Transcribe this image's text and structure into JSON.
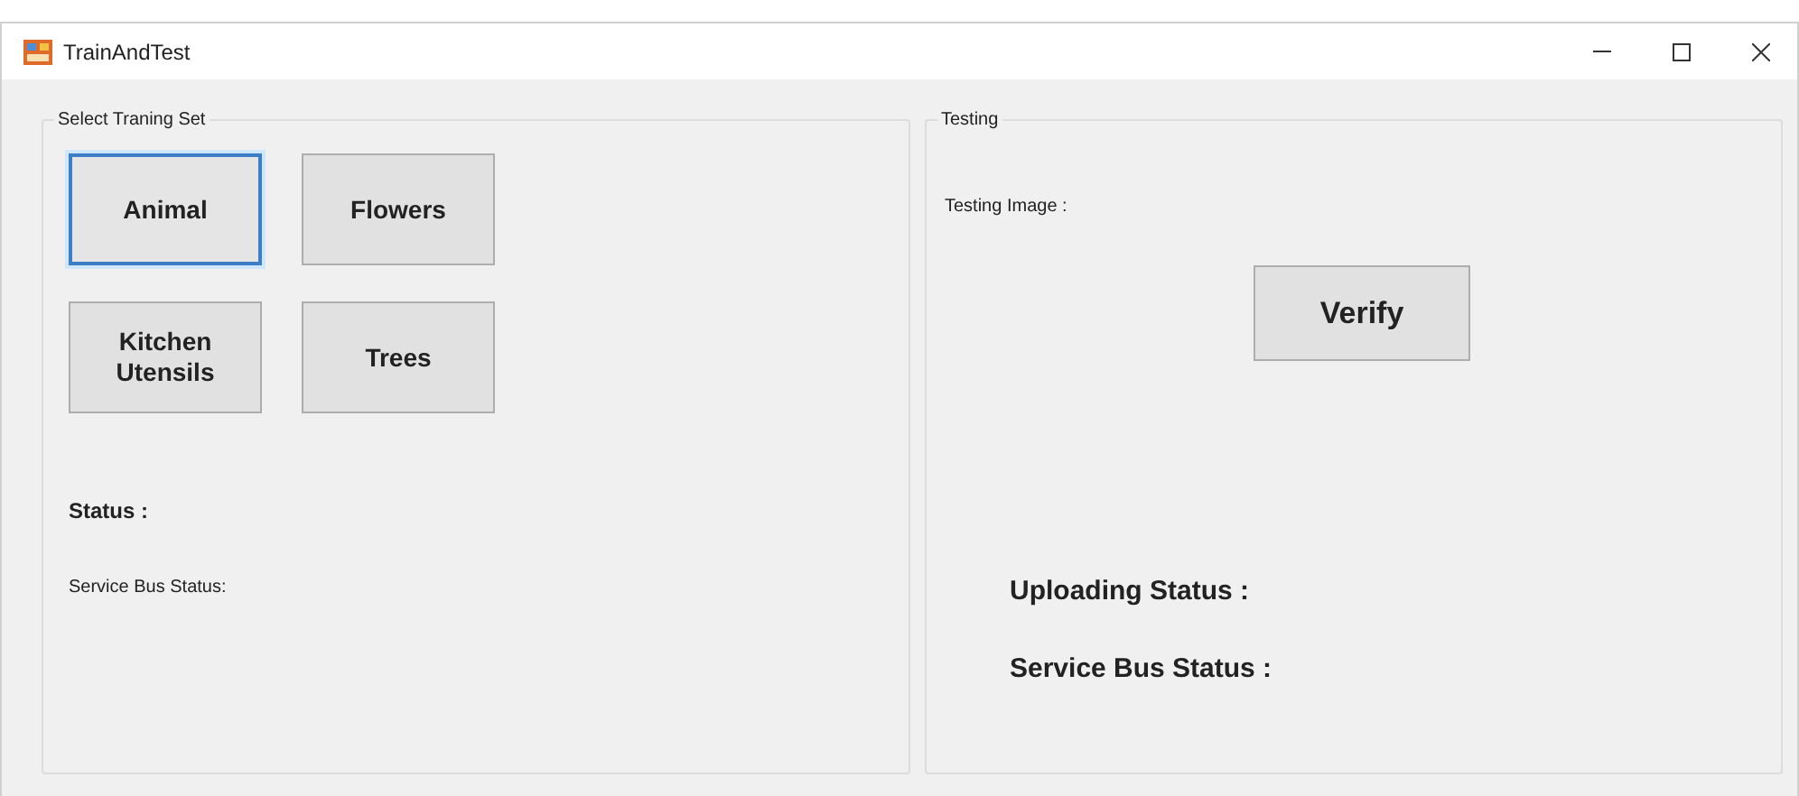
{
  "window": {
    "title": "TrainAndTest"
  },
  "training_group": {
    "title": "Select Traning Set",
    "buttons": [
      {
        "label": "Animal",
        "selected": true
      },
      {
        "label": "Flowers",
        "selected": false
      },
      {
        "label": "Kitchen\nUtensils",
        "selected": false
      },
      {
        "label": "Trees",
        "selected": false
      }
    ],
    "status_label": "Status :",
    "service_bus_status": "Service Bus Status:"
  },
  "testing_group": {
    "title": "Testing",
    "testing_image_label": "Testing Image :",
    "verify_button": "Verify",
    "uploading_status": "Uploading Status :",
    "service_bus_status": "Service Bus Status :"
  }
}
